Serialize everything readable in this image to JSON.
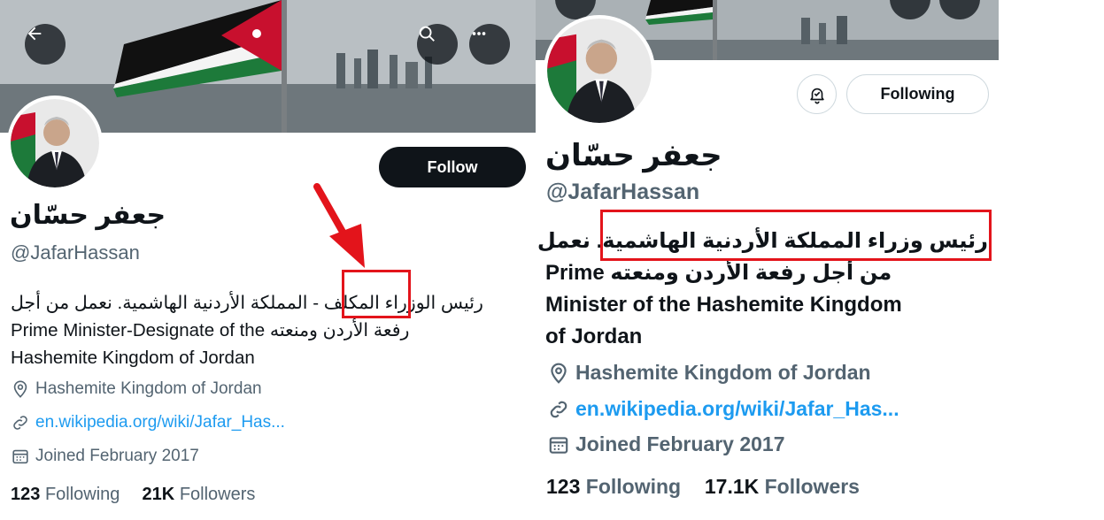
{
  "colors": {
    "accent": "#1d9bf0",
    "annotation_red": "#e3141b",
    "button_dark": "#0f1419",
    "muted_text": "#536471"
  },
  "left": {
    "icons": {
      "back": "arrow-left-icon",
      "search": "search-icon",
      "more": "more-horizontal-icon"
    },
    "follow_label": "Follow",
    "name": "جعفر حسّان",
    "handle": "@JafarHassan",
    "bio": {
      "line1_part1": "رئيس الوزراء",
      "line1_highlight": "المكلف",
      "line1_part2": "- المملكة الأردنية الهاشمية. نعمل من أجل",
      "line2_en": "Prime Minister-Designate of the",
      "line2_ar": "رفعة الأردن ومنعته",
      "line3": "Hashemite Kingdom of Jordan"
    },
    "location": "Hashemite Kingdom of Jordan",
    "website": "en.wikipedia.org/wiki/Jafar_Has...",
    "joined": "Joined February 2017",
    "following_count": "123",
    "following_label": "Following",
    "followers_count": "21K",
    "followers_label": "Followers"
  },
  "right": {
    "icons": {
      "notifications": "bell-icon"
    },
    "following_button_label": "Following",
    "name": "جعفر حسّان",
    "handle": "@JafarHassan",
    "bio": {
      "line1_highlight": "رئيس وزراء المملكة الأردنية الهاشمية.",
      "line1_rest": "نعمل",
      "line2_en": "Prime",
      "line2_ar": "من أجل رفعة الأردن ومنعته",
      "line3": "Minister of the Hashemite Kingdom",
      "line4": "of Jordan"
    },
    "location": "Hashemite Kingdom of Jordan",
    "website": "en.wikipedia.org/wiki/Jafar_Has...",
    "joined": "Joined February 2017",
    "following_count": "123",
    "following_label": "Following",
    "followers_count": "17.1K",
    "followers_label": "Followers"
  }
}
